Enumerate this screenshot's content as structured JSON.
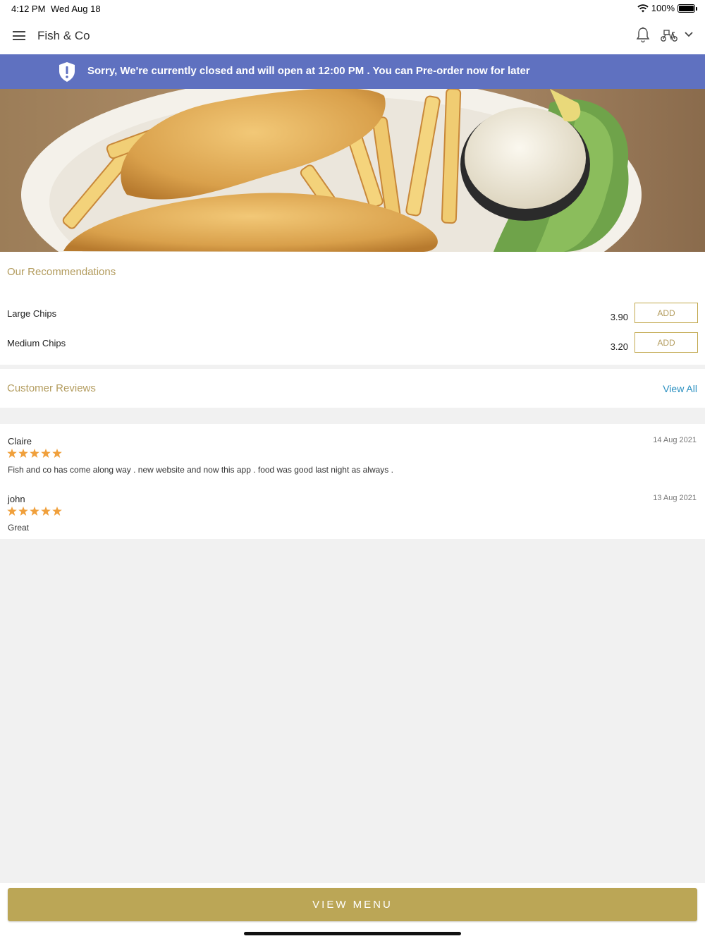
{
  "status_bar": {
    "time": "4:12 PM",
    "date": "Wed Aug 18",
    "battery": "100%"
  },
  "header": {
    "title": "Fish & Co",
    "icons": [
      "menu-icon",
      "bell-icon",
      "scooter-icon",
      "chevron-down-icon"
    ]
  },
  "banner": {
    "message": "Sorry, We're currently closed and will open at 12:00 PM . You can Pre-order now for later",
    "icon": "shield-alert-icon",
    "color": "#5f71c0"
  },
  "recommendations": {
    "title": "Our Recommendations",
    "items": [
      {
        "name": "Large Chips",
        "price": "3.90",
        "action": "ADD"
      },
      {
        "name": "Medium Chips",
        "price": "3.20",
        "action": "ADD"
      }
    ]
  },
  "reviews": {
    "title": "Customer Reviews",
    "view_all": "View All",
    "items": [
      {
        "author": "Claire",
        "date": "14 Aug 2021",
        "rating": 5,
        "text": "Fish and co has come along way . new website and now this app . food was good last night as always ."
      },
      {
        "author": "john",
        "date": "13 Aug 2021",
        "rating": 5,
        "text": "Great"
      }
    ]
  },
  "footer": {
    "button": "VIEW MENU"
  },
  "colors": {
    "accent": "#bba656",
    "heading": "#b39c5e",
    "link": "#2a8fc0",
    "star": "#f0a03c"
  }
}
